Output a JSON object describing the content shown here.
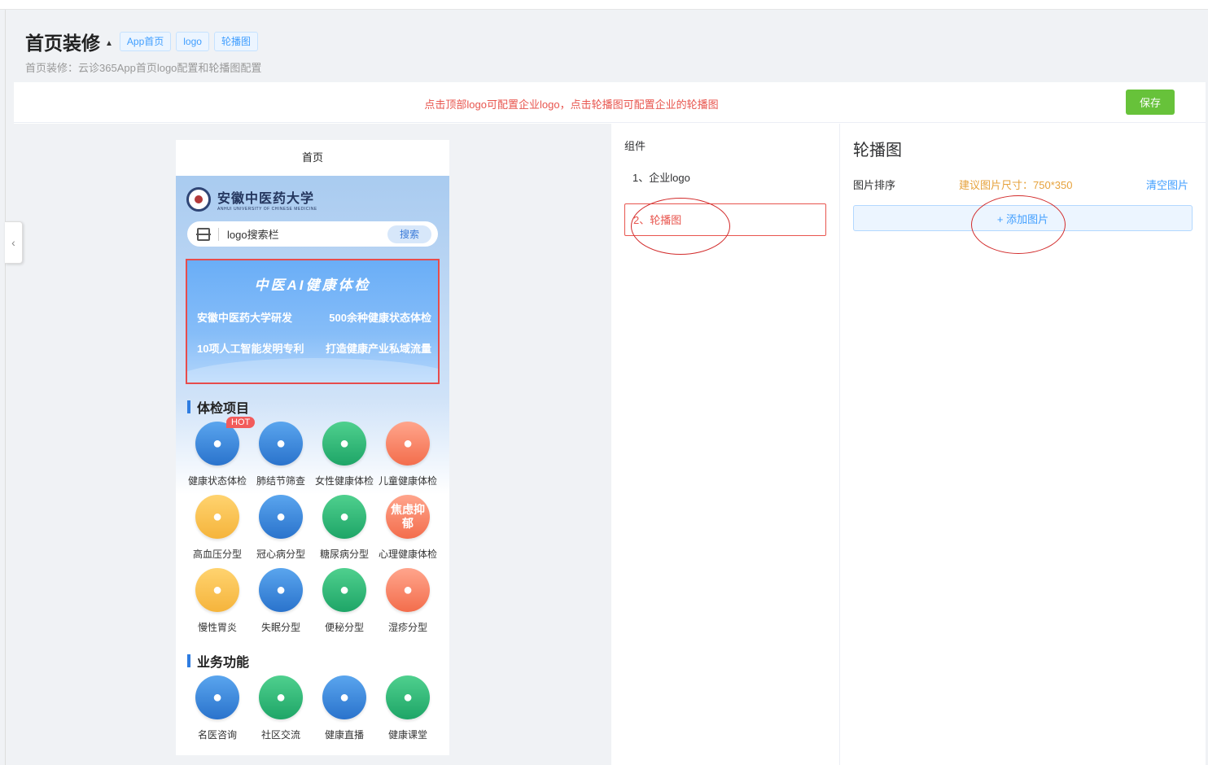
{
  "page": {
    "title": "首页装修",
    "caret": "▲",
    "tags": [
      "App首页",
      "logo",
      "轮播图"
    ],
    "subtitle": "首页装修：云诊365App首页logo配置和轮播图配置"
  },
  "notice": {
    "text": "点击顶部logo可配置企业logo，点击轮播图可配置企业的轮播图",
    "save_label": "保存"
  },
  "preview": {
    "phone_title": "首页",
    "logo_text": "安徽中医药大学",
    "logo_subtext": "ANHUI UNIVERSITY OF CHINESE MEDICINE",
    "search_placeholder": "logo搜索栏",
    "search_button": "搜索",
    "banner": {
      "title": "中医AI健康体检",
      "line1_left": "安徽中医药大学研发",
      "line1_right": "500余种健康状态体检",
      "line2_left": "10项人工智能发明专利",
      "line2_right": "打造健康产业私域流量"
    },
    "section1_title": "体检项目",
    "hot_badge": "HOT",
    "exam_items": [
      {
        "label": "健康状态体检",
        "icon": "health-check-icon",
        "color": "blue"
      },
      {
        "label": "肺结节筛查",
        "icon": "lungs-icon",
        "color": "blue"
      },
      {
        "label": "女性健康体检",
        "icon": "woman-icon",
        "color": "green"
      },
      {
        "label": "儿童健康体检",
        "icon": "child-icon",
        "color": "orange"
      },
      {
        "label": "高血压分型",
        "icon": "stethoscope-icon",
        "color": "yellow"
      },
      {
        "label": "冠心病分型",
        "icon": "heart-icon",
        "color": "blue"
      },
      {
        "label": "糖尿病分型",
        "icon": "blood-drops-icon",
        "color": "green"
      },
      {
        "label": "心理健康体检",
        "icon": "anxiety-icon",
        "color": "orange",
        "icon_text": "焦虑抑郁"
      },
      {
        "label": "慢性胃炎",
        "icon": "stomach-icon",
        "color": "yellow"
      },
      {
        "label": "失眠分型",
        "icon": "sleep-icon",
        "color": "blue"
      },
      {
        "label": "便秘分型",
        "icon": "toilet-icon",
        "color": "green"
      },
      {
        "label": "湿疹分型",
        "icon": "hand-icon",
        "color": "orange"
      }
    ],
    "section2_title": "业务功能",
    "business_items": [
      {
        "label": "名医咨询",
        "icon": "doctor-icon",
        "color": "blue"
      },
      {
        "label": "社区交流",
        "icon": "community-icon",
        "color": "green"
      },
      {
        "label": "健康直播",
        "icon": "video-icon",
        "color": "blue"
      },
      {
        "label": "健康课堂",
        "icon": "book-icon",
        "color": "green"
      }
    ]
  },
  "components": {
    "title": "组件",
    "items": [
      "1、企业logo",
      "2、轮播图"
    ]
  },
  "settings": {
    "title": "轮播图",
    "sort_label": "图片排序",
    "size_hint": "建议图片尺寸：750*350",
    "clear_label": "清空图片",
    "add_label": "+ 添加图片"
  },
  "colors": {
    "accent": "#409eff",
    "save": "#67c23a",
    "notice": "#e8554e",
    "annotation": "#d22b2b"
  }
}
